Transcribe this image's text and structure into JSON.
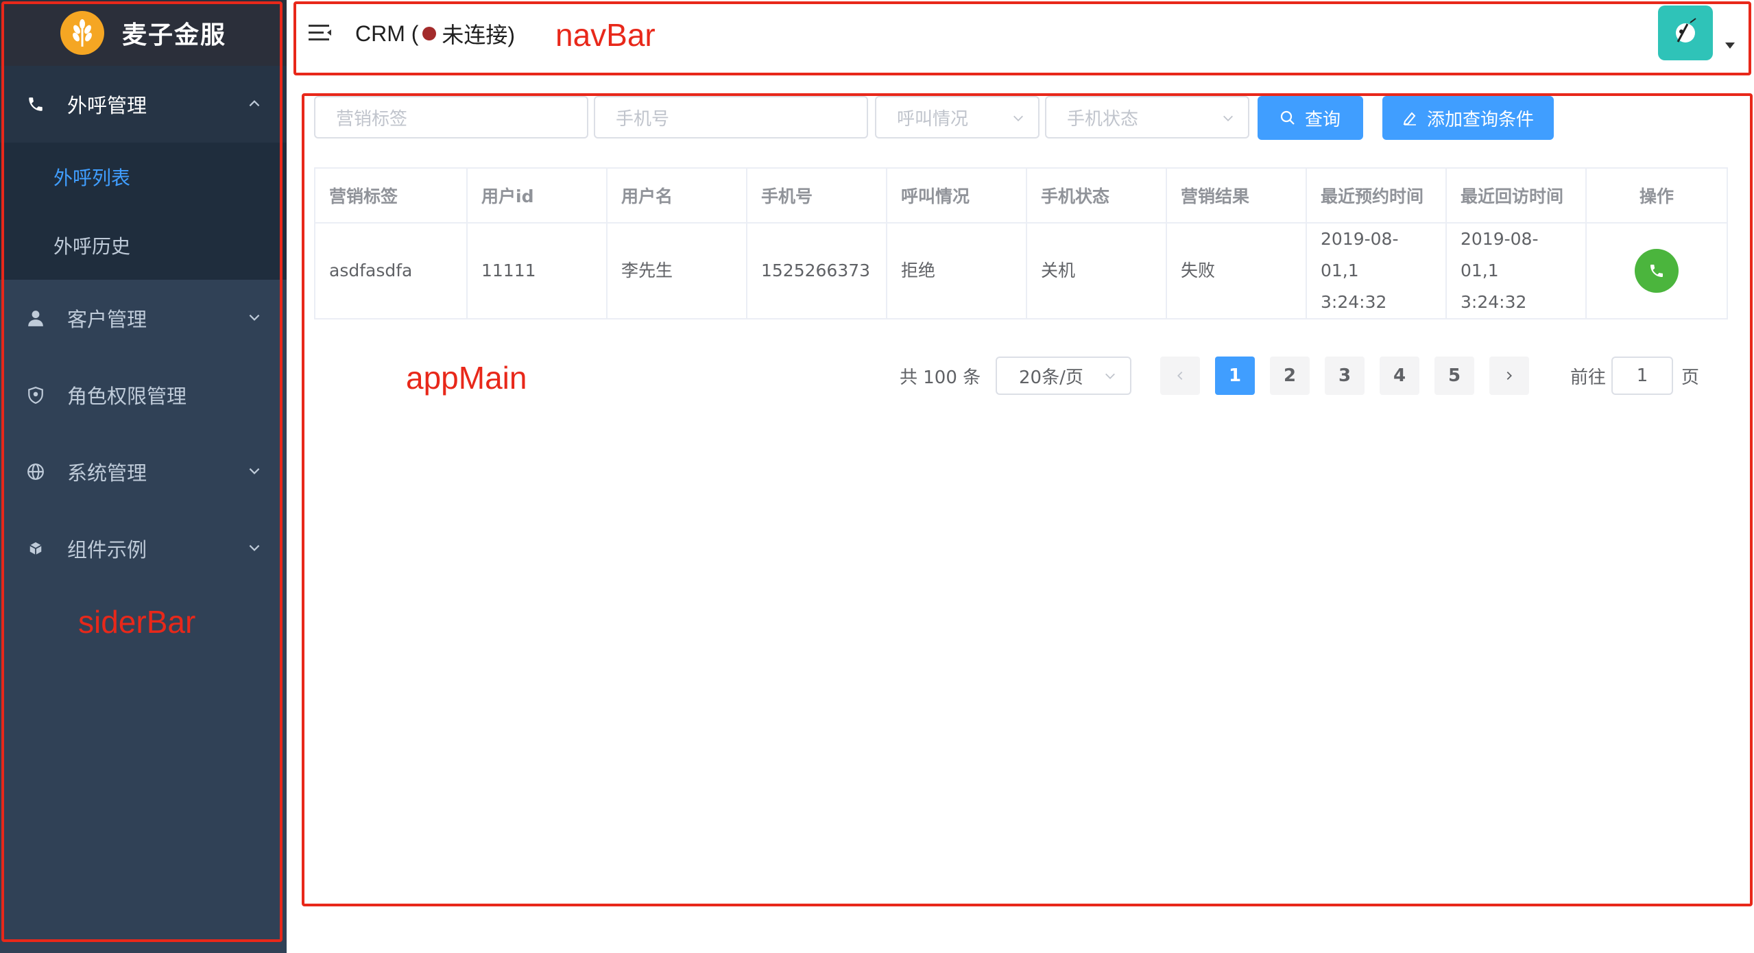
{
  "sidebar": {
    "logo_title": "麦子金服",
    "annotation": "siderBar",
    "menu": [
      {
        "label": "外呼管理",
        "icon": "phone-icon",
        "open": true,
        "children": [
          {
            "label": "外呼列表",
            "active": true
          },
          {
            "label": "外呼历史",
            "active": false
          }
        ]
      },
      {
        "label": "客户管理",
        "icon": "user-icon"
      },
      {
        "label": "角色权限管理",
        "icon": "shield-icon"
      },
      {
        "label": "系统管理",
        "icon": "globe-icon"
      },
      {
        "label": "组件示例",
        "icon": "cube-icon"
      }
    ]
  },
  "navbar": {
    "title_prefix": "CRM (",
    "status_text": "未连接)",
    "annotation": "navBar"
  },
  "filters": {
    "marketing_tag_placeholder": "营销标签",
    "phone_placeholder": "手机号",
    "call_status_placeholder": "呼叫情况",
    "phone_status_placeholder": "手机状态",
    "search_label": "查询",
    "add_condition_label": "添加查询条件"
  },
  "table": {
    "headers": [
      "营销标签",
      "用户id",
      "用户名",
      "手机号",
      "呼叫情况",
      "手机状态",
      "营销结果",
      "最近预约时间",
      "最近回访时间",
      "操作"
    ],
    "rows": [
      {
        "tag": "asdfasdfa",
        "user_id": "11111",
        "user_name": "李先生",
        "phone": "1525266373",
        "call_status": "拒绝",
        "phone_status": "关机",
        "result": "失败",
        "recent_appointment_line1": "2019-08-01,1",
        "recent_appointment_line2": "3:24:32",
        "recent_visit_line1": "2019-08-01,1",
        "recent_visit_line2": "3:24:32"
      }
    ]
  },
  "pagination": {
    "total": "共 100 条",
    "page_size": "20条/页",
    "pages": [
      "1",
      "2",
      "3",
      "4",
      "5"
    ],
    "active_page": "1",
    "goto_prefix": "前往",
    "goto_value": "1",
    "goto_suffix": "页"
  },
  "main_annotation": "appMain",
  "colors": {
    "sidebar_bg": "#304156",
    "accent": "#409eff",
    "annotation_red": "#e8281a",
    "call_green": "#4bb53d"
  }
}
